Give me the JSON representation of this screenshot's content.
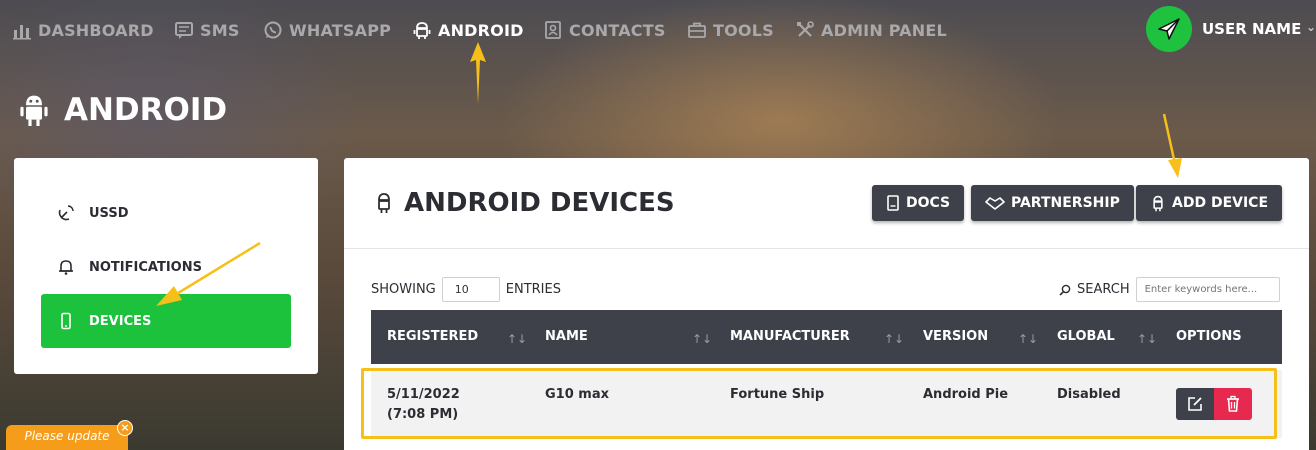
{
  "nav": {
    "items": [
      {
        "label": "DASHBOARD",
        "icon": "bar-chart-icon"
      },
      {
        "label": "SMS",
        "icon": "message-icon"
      },
      {
        "label": "WHATSAPP",
        "icon": "whatsapp-icon"
      },
      {
        "label": "ANDROID",
        "icon": "android-icon",
        "active": true
      },
      {
        "label": "CONTACTS",
        "icon": "contacts-icon"
      },
      {
        "label": "TOOLS",
        "icon": "briefcase-icon"
      },
      {
        "label": "ADMIN PANEL",
        "icon": "tools-icon"
      }
    ],
    "user_name": "USER NAME"
  },
  "page_title": "ANDROID",
  "sidebar": {
    "items": [
      {
        "label": "USSD",
        "icon": "satellite-dish-icon"
      },
      {
        "label": "NOTIFICATIONS",
        "icon": "bell-icon"
      },
      {
        "label": "DEVICES",
        "icon": "mobile-icon",
        "active": true
      }
    ]
  },
  "main": {
    "title": "ANDROID DEVICES",
    "buttons": {
      "docs": "DOCS",
      "partnership": "PARTNERSHIP",
      "add_device": "ADD DEVICE"
    },
    "showing_label": "SHOWING",
    "entries_value": "10",
    "entries_label": "ENTRIES",
    "search_label": "SEARCH",
    "search_placeholder": "Enter keywords here...",
    "table": {
      "columns": [
        "REGISTERED",
        "NAME",
        "MANUFACTURER",
        "VERSION",
        "GLOBAL",
        "OPTIONS"
      ],
      "rows": [
        {
          "registered_date": "5/11/2022",
          "registered_time": "(7:08 PM)",
          "name": "G10 max",
          "manufacturer": "Fortune Ship",
          "version": "Android Pie",
          "global": "Disabled"
        }
      ]
    }
  },
  "notice": {
    "text": "Please update"
  },
  "colors": {
    "accent_green": "#1cc23c",
    "annotation_arrow": "#f6bf19",
    "header_dark": "#3e414a",
    "delete_red": "#e8294f"
  }
}
